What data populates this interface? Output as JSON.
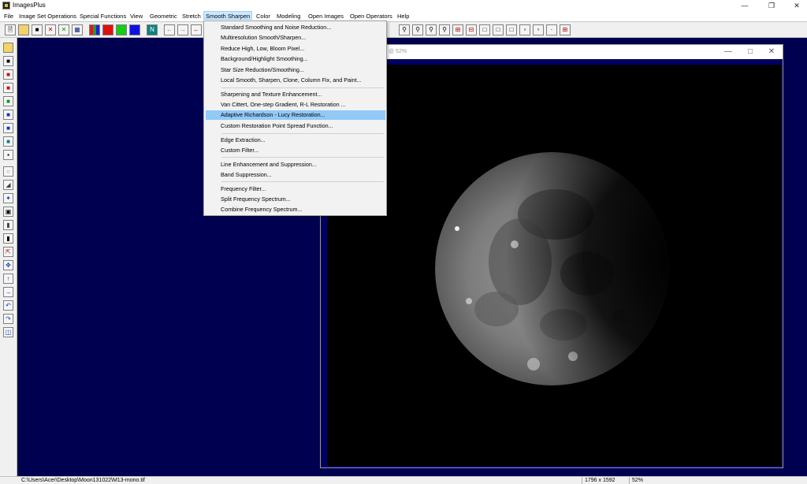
{
  "window": {
    "title": "ImagesPlus"
  },
  "menubar": {
    "items": [
      "File",
      "Image Set Operations",
      "Special Functions",
      "View",
      "Geometric",
      "Stretch",
      "Smooth Sharpen",
      "Color",
      "Modeling",
      "Open Images",
      "Open Operators",
      "Help"
    ],
    "active": "Smooth Sharpen"
  },
  "smooth_sharpen_menu": {
    "items": [
      "Standard Smoothing and Noise Reduction...",
      "Multiresolution Smooth/Sharpen...",
      "Reduce High, Low, Bloom Pixel...",
      "Background/Highlight Smoothing...",
      "Star Size Reduction/Smoothing...",
      "Local Smooth, Sharpen, Clone, Column Fix, and Paint...",
      "Sharpening and Texture Enhancement...",
      "Van Cittert, One-step Gradient, R-L Restoration ...",
      "Adaptive Richardson - Lucy Restoration...",
      "Custom Restoration Point Spread Function...",
      "Edge Extraction...",
      "Custom Filter...",
      "Line Enhancement and Suppression...",
      "Band Suppression...",
      "Frequency Filter...",
      "Split Frequency Spectrum...",
      "Combine Frequency Spectrum..."
    ],
    "highlighted": "Adaptive Richardson - Lucy Restoration..."
  },
  "image_window": {
    "title_partial": "@ 52%"
  },
  "statusbar": {
    "path": "C:\\Users\\Acer\\Desktop\\Moon131022\\M13-mono.tif",
    "dimensions": "1796 x 1592",
    "zoom": "52%"
  },
  "colors": {
    "workspace": "#000050",
    "menu_highlight": "#91c9f7",
    "image_frame": "#000060"
  },
  "icons": {
    "toolbar": [
      "new-file-icon",
      "open-folder-icon",
      "save-disk-icon",
      "close-x-icon",
      "apply-check-icon",
      "settings-icon",
      "rgb-channels-icon",
      "red-channel-icon",
      "green-channel-icon",
      "blue-channel-icon",
      "luminance-icon",
      "arrow-left-icon",
      "arrow-right-icon",
      "undo-icon",
      "zoom-in-icon",
      "zoom-out-icon",
      "zoom-fit-icon",
      "zoom-actual-icon",
      "plus-box-icon",
      "minus-box-icon",
      "frame-icons",
      "grid-icon"
    ]
  }
}
